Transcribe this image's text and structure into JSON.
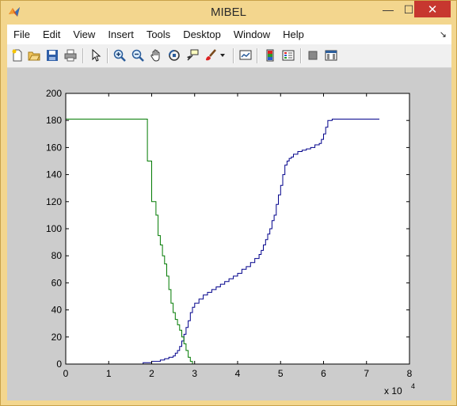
{
  "window": {
    "title": "MIBEL",
    "controls": {
      "minimize": "—",
      "maximize": "☐",
      "close": "✕"
    }
  },
  "menubar": {
    "items": [
      "File",
      "Edit",
      "View",
      "Insert",
      "Tools",
      "Desktop",
      "Window",
      "Help"
    ],
    "dock_icon": "dock-arrow-icon"
  },
  "toolbar": {
    "icons": [
      "new-figure-icon",
      "open-file-icon",
      "save-icon",
      "print-icon",
      "edit-plot-arrow-icon",
      "zoom-in-icon",
      "zoom-out-icon",
      "pan-hand-icon",
      "rotate-3d-icon",
      "data-cursor-icon",
      "brush-icon",
      "brush-dropdown-icon",
      "link-plot-icon",
      "insert-colorbar-icon",
      "insert-legend-icon",
      "hide-plot-tools-icon",
      "show-plot-tools-icon"
    ]
  },
  "colors": {
    "title_bar": "#f3d68e",
    "close_button": "#c7372f",
    "figure_background": "#cccccc",
    "axes_background": "#ffffff",
    "series_blue": "#00008b",
    "series_green": "#007a00"
  },
  "chart_data": {
    "type": "line",
    "title": "",
    "xlabel": "",
    "ylabel": "",
    "xlim": [
      0,
      80000
    ],
    "ylim": [
      0,
      200
    ],
    "x_ticks": [
      0,
      1,
      2,
      3,
      4,
      5,
      6,
      7,
      8
    ],
    "x_tick_labels": [
      "0",
      "1",
      "2",
      "3",
      "4",
      "5",
      "6",
      "7",
      "8"
    ],
    "x_exponent_label": "x 10",
    "x_exponent_power": "4",
    "y_ticks": [
      0,
      20,
      40,
      60,
      80,
      100,
      120,
      140,
      160,
      180,
      200
    ],
    "y_tick_labels": [
      "0",
      "20",
      "40",
      "60",
      "80",
      "100",
      "120",
      "140",
      "160",
      "180",
      "200"
    ],
    "grid": false,
    "series": [
      {
        "color": "#00008b",
        "step": true,
        "x": [
          0,
          17000,
          18000,
          19000,
          20000,
          21000,
          22000,
          22500,
          23000,
          24000,
          25000,
          25500,
          26000,
          26500,
          27000,
          27500,
          28000,
          28500,
          29000,
          29500,
          30000,
          31000,
          32000,
          33000,
          34000,
          35000,
          36000,
          37000,
          38000,
          39000,
          40000,
          41000,
          42000,
          43000,
          44000,
          45000,
          45500,
          46000,
          46500,
          47000,
          47500,
          48000,
          48500,
          49000,
          49500,
          50000,
          50500,
          51000,
          51500,
          52000,
          52500,
          53000,
          54000,
          55000,
          56000,
          57000,
          58000,
          59000,
          59500,
          60000,
          60500,
          61000,
          62000,
          65000,
          70000,
          73000
        ],
        "y": [
          0,
          0,
          1,
          1,
          2,
          2,
          3,
          3,
          4,
          5,
          6,
          8,
          10,
          13,
          17,
          22,
          27,
          32,
          38,
          42,
          45,
          48,
          51,
          53,
          55,
          57,
          59,
          61,
          63,
          65,
          67,
          70,
          72,
          75,
          78,
          81,
          84,
          88,
          92,
          96,
          100,
          106,
          110,
          118,
          125,
          132,
          140,
          147,
          150,
          152,
          153,
          155,
          157,
          158,
          159,
          160,
          162,
          163,
          166,
          170,
          175,
          180,
          181,
          181,
          181,
          181
        ]
      },
      {
        "color": "#007a00",
        "step": true,
        "x": [
          0,
          18500,
          19000,
          20000,
          21000,
          21500,
          22000,
          22500,
          23000,
          23500,
          24000,
          24500,
          25000,
          25500,
          26000,
          26500,
          27000,
          27500,
          28000,
          28500,
          29000,
          29500,
          30000,
          35000
        ],
        "y": [
          181,
          181,
          150,
          120,
          110,
          95,
          88,
          80,
          74,
          65,
          55,
          45,
          38,
          33,
          29,
          25,
          20,
          15,
          10,
          5,
          2,
          0,
          0,
          0
        ]
      }
    ]
  }
}
